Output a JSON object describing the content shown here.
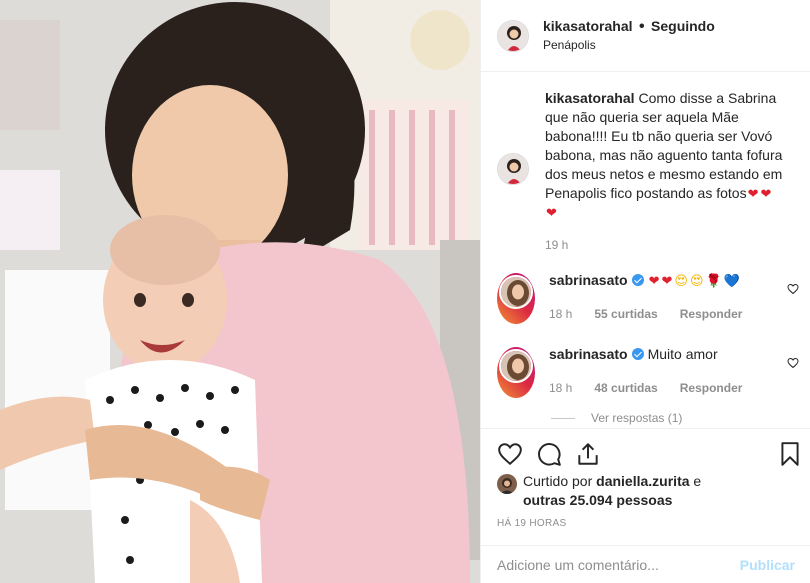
{
  "header": {
    "username": "kikasatorahal",
    "separator": "•",
    "follow_label": "Seguindo",
    "location": "Penápolis"
  },
  "caption": {
    "username": "kikasatorahal",
    "text": "Como disse a Sabrina que não queria ser aquela Mãe babona!!!! Eu tb não queria ser Vovó babona, mas não aguento tanta fofura dos meus netos e mesmo estando em Penapolis fico postando as fotos",
    "emojis": [
      "red-heart",
      "red-heart",
      "red-heart"
    ],
    "time": "19 h"
  },
  "comments": [
    {
      "username": "sabrinasato",
      "verified": true,
      "text": "",
      "emojis": [
        "red-heart",
        "red-heart",
        "heart-eyes",
        "heart-eyes",
        "rose",
        "blue-heart"
      ],
      "time": "18 h",
      "likes": "55 curtidas",
      "reply_label": "Responder"
    },
    {
      "username": "sabrinasato",
      "verified": true,
      "text": "Muito amor",
      "emojis": [],
      "time": "18 h",
      "likes": "48 curtidas",
      "reply_label": "Responder"
    }
  ],
  "view_replies": "Ver respostas (1)",
  "actions": {
    "icons": [
      "heart-icon",
      "comment-icon",
      "share-icon",
      "bookmark-icon"
    ]
  },
  "likes": {
    "prefix": "Curtido por",
    "user": "daniella.zurita",
    "connector": "e",
    "others": "outras 25.094 pessoas"
  },
  "timestamp": "HÁ 19 HORAS",
  "comment_box": {
    "placeholder": "Adicione um comentário...",
    "publish_label": "Publicar"
  },
  "colors": {
    "text": "#262626",
    "muted": "#8e8e8e",
    "border": "#efefef",
    "verified": "#3897f0",
    "publish_disabled": "#b2dffc",
    "emoji_red": "#e0202e"
  }
}
